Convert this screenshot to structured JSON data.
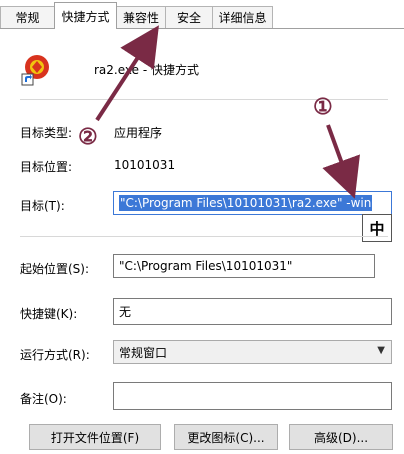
{
  "tabs": [
    {
      "label": "常规",
      "active": false
    },
    {
      "label": "快捷方式",
      "active": true
    },
    {
      "label": "兼容性",
      "active": false
    },
    {
      "label": "安全",
      "active": false
    },
    {
      "label": "详细信息",
      "active": false
    }
  ],
  "app": {
    "name": "ra2.exe - 快捷方式",
    "icon": "red-alert-app-icon"
  },
  "fields": {
    "target_type_label": "目标类型:",
    "target_type_value": "应用程序",
    "target_location_label": "目标位置:",
    "target_location_value": "10101031",
    "target_label": "目标(T):",
    "target_value": "\"C:\\Program Files\\10101031\\ra2.exe\" -win",
    "start_in_label": "起始位置(S):",
    "start_in_value": "\"C:\\Program Files\\10101031\"",
    "shortcut_key_label": "快捷键(K):",
    "shortcut_key_value": "无",
    "run_label": "运行方式(R):",
    "run_value": "常规窗口",
    "comment_label": "备注(O):",
    "comment_value": ""
  },
  "ime_indicator": "中",
  "buttons": {
    "open_location": "打开文件位置(F)",
    "change_icon": "更改图标(C)...",
    "advanced": "高级(D)..."
  },
  "annotations": {
    "one": "①",
    "two": "②"
  },
  "colors": {
    "annotation": "#7a2a45",
    "selection": "#3c78d7"
  }
}
